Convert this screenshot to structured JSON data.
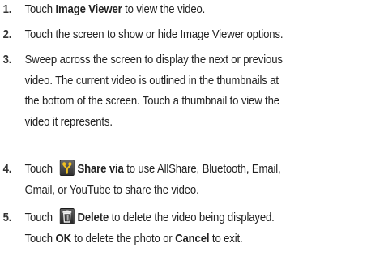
{
  "steps": [
    {
      "number": "1.",
      "parts": {
        "a": "Touch ",
        "b": "Image Viewer",
        "c": " to view the video."
      }
    },
    {
      "number": "2.",
      "text": "Touch the screen to show or hide Image Viewer options."
    },
    {
      "number": "3.",
      "lines": [
        "Sweep across the screen to display the next or previous",
        "video. The current video is outlined in the thumbnails at",
        "the bottom of the screen. Touch a thumbnail to view the",
        "video it represents."
      ]
    },
    {
      "number": "4.",
      "parts": {
        "a": "Touch ",
        "icon": "share-via-icon",
        "b": "Share via",
        "c": " to use AllShare, Bluetooth, Email,",
        "d": "Gmail, or YouTube to share the video."
      }
    },
    {
      "number": "5.",
      "parts": {
        "a": "Touch ",
        "icon": "delete-trash-icon",
        "b": "Delete",
        "c": " to delete the video being displayed.",
        "d": "Touch ",
        "e": "OK",
        "f": " to delete the photo or ",
        "g": "Cancel",
        "h": " to exit."
      }
    }
  ]
}
